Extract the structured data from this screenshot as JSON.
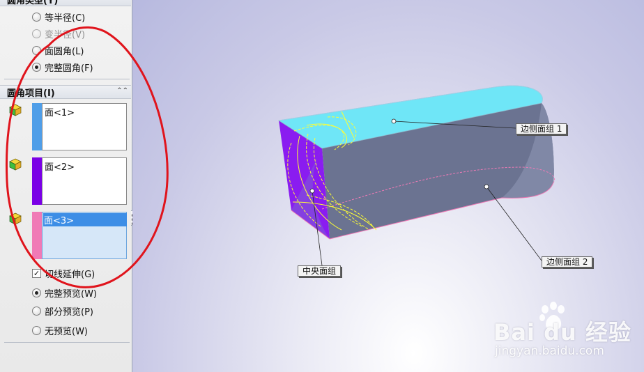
{
  "panel": {
    "fillet_type": {
      "header": "圆角类型(Y)",
      "options": [
        {
          "label": "等半径(C)",
          "selected": false,
          "enabled": true
        },
        {
          "label": "变半径(V)",
          "selected": false,
          "enabled": false
        },
        {
          "label": "面圆角(L)",
          "selected": false,
          "enabled": true
        },
        {
          "label": "完整圆角(F)",
          "selected": true,
          "enabled": true
        }
      ]
    },
    "fillet_items": {
      "header": "圆角项目(I)",
      "faces": [
        {
          "label": "面<1>",
          "color": "#4f9ee8"
        },
        {
          "label": "面<2>",
          "color": "#7a00e6"
        },
        {
          "label": "面<3>",
          "color": "#f07ab6",
          "selected": true
        }
      ]
    },
    "tangent_propagation": {
      "label": "切线延伸(G)",
      "checked": true
    },
    "preview": {
      "options": [
        {
          "label": "完整预览(W)",
          "selected": true
        },
        {
          "label": "部分预览(P)",
          "selected": false
        },
        {
          "label": "无预览(W)",
          "selected": false
        }
      ]
    }
  },
  "viewport": {
    "callouts": {
      "side_face_1": "边侧面组 1",
      "center_face": "中央面组",
      "side_face_2": "边侧面组 2"
    },
    "colors": {
      "top_face": "#6fe6f7",
      "center_face": "#8a1cf0",
      "body": "#6e7592",
      "preview": "#ffff33"
    }
  },
  "watermark": {
    "brand": "Bai du 经验",
    "url": "jingyan.baidu.com"
  }
}
